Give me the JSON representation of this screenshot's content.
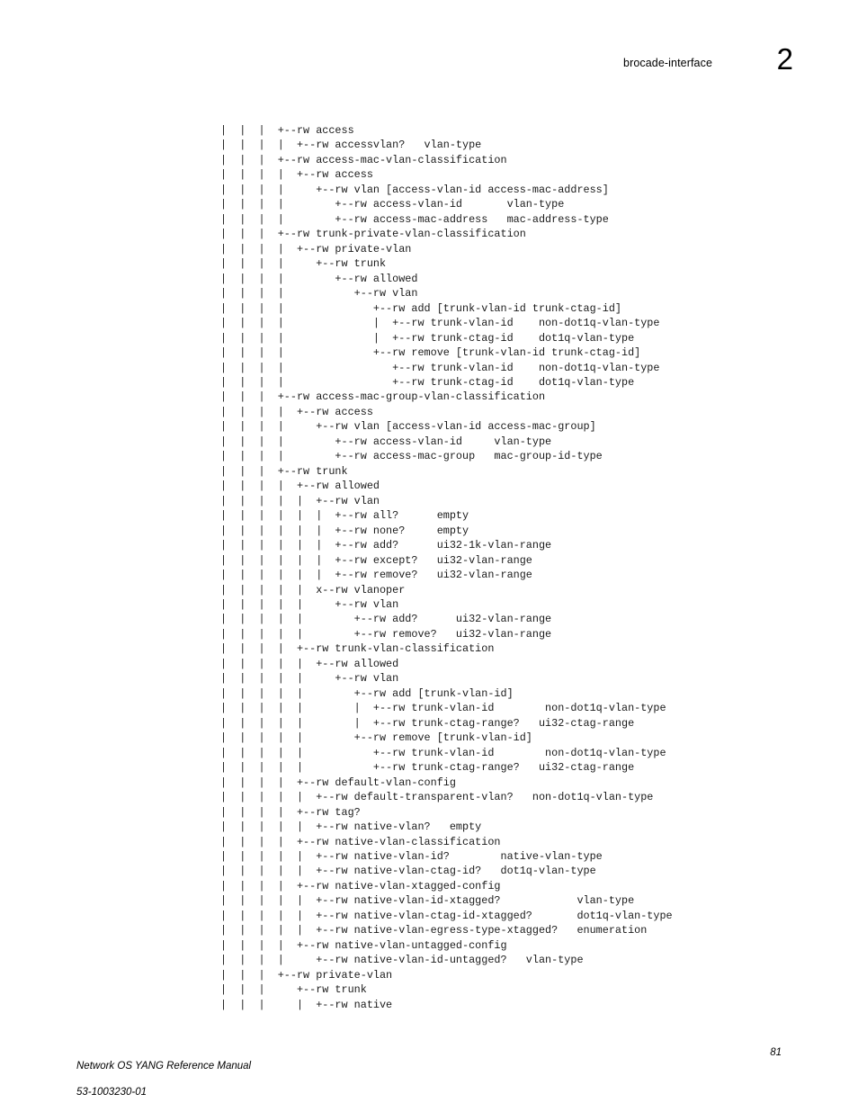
{
  "header": {
    "module_name": "brocade-interface",
    "chapter_number": "2"
  },
  "footer": {
    "document_title": "Network OS YANG Reference Manual",
    "document_number": "53-1003230-01",
    "page_number": "81"
  },
  "tree": {
    "lines": [
      "|  |  |  +--rw access",
      "|  |  |  |  +--rw accessvlan?   vlan-type",
      "|  |  |  +--rw access-mac-vlan-classification",
      "|  |  |  |  +--rw access",
      "|  |  |  |     +--rw vlan [access-vlan-id access-mac-address]",
      "|  |  |  |        +--rw access-vlan-id       vlan-type",
      "|  |  |  |        +--rw access-mac-address   mac-address-type",
      "|  |  |  +--rw trunk-private-vlan-classification",
      "|  |  |  |  +--rw private-vlan",
      "|  |  |  |     +--rw trunk",
      "|  |  |  |        +--rw allowed",
      "|  |  |  |           +--rw vlan",
      "|  |  |  |              +--rw add [trunk-vlan-id trunk-ctag-id]",
      "|  |  |  |              |  +--rw trunk-vlan-id    non-dot1q-vlan-type",
      "|  |  |  |              |  +--rw trunk-ctag-id    dot1q-vlan-type",
      "|  |  |  |              +--rw remove [trunk-vlan-id trunk-ctag-id]",
      "|  |  |  |                 +--rw trunk-vlan-id    non-dot1q-vlan-type",
      "|  |  |  |                 +--rw trunk-ctag-id    dot1q-vlan-type",
      "|  |  |  +--rw access-mac-group-vlan-classification",
      "|  |  |  |  +--rw access",
      "|  |  |  |     +--rw vlan [access-vlan-id access-mac-group]",
      "|  |  |  |        +--rw access-vlan-id     vlan-type",
      "|  |  |  |        +--rw access-mac-group   mac-group-id-type",
      "|  |  |  +--rw trunk",
      "|  |  |  |  +--rw allowed",
      "|  |  |  |  |  +--rw vlan",
      "|  |  |  |  |  |  +--rw all?      empty",
      "|  |  |  |  |  |  +--rw none?     empty",
      "|  |  |  |  |  |  +--rw add?      ui32-1k-vlan-range",
      "|  |  |  |  |  |  +--rw except?   ui32-vlan-range",
      "|  |  |  |  |  |  +--rw remove?   ui32-vlan-range",
      "|  |  |  |  |  x--rw vlanoper",
      "|  |  |  |  |     +--rw vlan",
      "|  |  |  |  |        +--rw add?      ui32-vlan-range",
      "|  |  |  |  |        +--rw remove?   ui32-vlan-range",
      "|  |  |  |  +--rw trunk-vlan-classification",
      "|  |  |  |  |  +--rw allowed",
      "|  |  |  |  |     +--rw vlan",
      "|  |  |  |  |        +--rw add [trunk-vlan-id]",
      "|  |  |  |  |        |  +--rw trunk-vlan-id        non-dot1q-vlan-type",
      "|  |  |  |  |        |  +--rw trunk-ctag-range?   ui32-ctag-range",
      "|  |  |  |  |        +--rw remove [trunk-vlan-id]",
      "|  |  |  |  |           +--rw trunk-vlan-id        non-dot1q-vlan-type",
      "|  |  |  |  |           +--rw trunk-ctag-range?   ui32-ctag-range",
      "|  |  |  |  +--rw default-vlan-config",
      "|  |  |  |  |  +--rw default-transparent-vlan?   non-dot1q-vlan-type",
      "|  |  |  |  +--rw tag?",
      "|  |  |  |  |  +--rw native-vlan?   empty",
      "|  |  |  |  +--rw native-vlan-classification",
      "|  |  |  |  |  +--rw native-vlan-id?        native-vlan-type",
      "|  |  |  |  |  +--rw native-vlan-ctag-id?   dot1q-vlan-type",
      "|  |  |  |  +--rw native-vlan-xtagged-config",
      "|  |  |  |  |  +--rw native-vlan-id-xtagged?            vlan-type",
      "|  |  |  |  |  +--rw native-vlan-ctag-id-xtagged?       dot1q-vlan-type",
      "|  |  |  |  |  +--rw native-vlan-egress-type-xtagged?   enumeration",
      "|  |  |  |  +--rw native-vlan-untagged-config",
      "|  |  |  |     +--rw native-vlan-id-untagged?   vlan-type",
      "|  |  |  +--rw private-vlan",
      "|  |  |     +--rw trunk",
      "|  |  |     |  +--rw native"
    ]
  }
}
